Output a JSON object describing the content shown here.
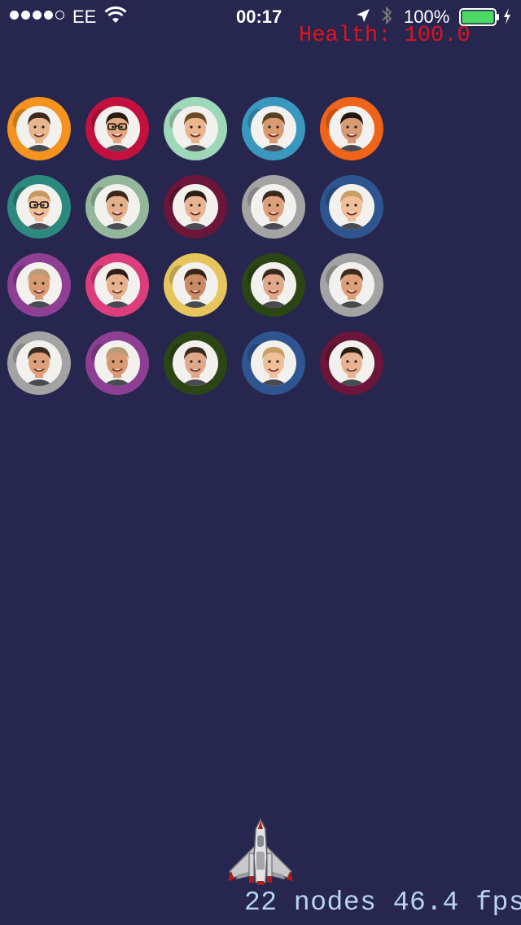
{
  "status_bar": {
    "carrier": "EE",
    "time": "00:17",
    "battery_percent": "100%",
    "signal_bars_filled": 4,
    "signal_bars_total": 5,
    "battery_level": 1.0,
    "battery_color": "#4cd964"
  },
  "hud": {
    "health_text": "Health: 100.0",
    "health_color": "#e0121d",
    "stats_text": "22 nodes 46.4 fps",
    "stats_color": "#b7d4f3"
  },
  "background_color": "#26264f",
  "enemies": [
    {
      "ring": "#f5931e",
      "hair": "#3a2a1c",
      "skin": "#e9b58e"
    },
    {
      "ring": "#c4103f",
      "hair": "#2b1d14",
      "skin": "#e2a982",
      "glasses": true
    },
    {
      "ring": "#9ed8b9",
      "hair": "#6b4b2a",
      "skin": "#eab48c"
    },
    {
      "ring": "#3a98bf",
      "hair": "#5a3f25",
      "skin": "#d99a72"
    },
    {
      "ring": "#ef6418",
      "hair": "#1e1712",
      "skin": "#d89a74"
    },
    {
      "ring": "#2b8a7d",
      "hair": "#c59a5e",
      "skin": "#efbf9a",
      "glasses": true
    },
    {
      "ring": "#94b79c",
      "hair": "#3b2818",
      "skin": "#e4b08c"
    },
    {
      "ring": "#6b1538",
      "hair": "#2a1d16",
      "skin": "#e7b391"
    },
    {
      "ring": "#a3a3a3",
      "hair": "#3b2a1e",
      "skin": "#dda07a"
    },
    {
      "ring": "#2f5590",
      "hair": "#c79e63",
      "skin": "#efbf99"
    },
    {
      "ring": "#8e3f94",
      "hair": "#b89c7a",
      "skin": "#d79a73"
    },
    {
      "ring": "#db3e7b",
      "hair": "#2d1e17",
      "skin": "#e7b08c"
    },
    {
      "ring": "#e6c55c",
      "hair": "#3a2518",
      "skin": "#c98a64"
    },
    {
      "ring": "#2b4614",
      "hair": "#3a2a1e",
      "skin": "#e0a888"
    },
    {
      "ring": "#a3a3a3",
      "hair": "#3b2a1e",
      "skin": "#dda07a"
    },
    {
      "ring": "#a3a3a3",
      "hair": "#3b2a1e",
      "skin": "#dda07a"
    },
    {
      "ring": "#8e3f94",
      "hair": "#b89c7a",
      "skin": "#d79a73"
    },
    {
      "ring": "#2b4614",
      "hair": "#3a2a1e",
      "skin": "#e0a888"
    },
    {
      "ring": "#2f5590",
      "hair": "#c79e63",
      "skin": "#efbf99"
    },
    {
      "ring": "#6b1538",
      "hair": "#2a1d16",
      "skin": "#e7b391"
    }
  ]
}
